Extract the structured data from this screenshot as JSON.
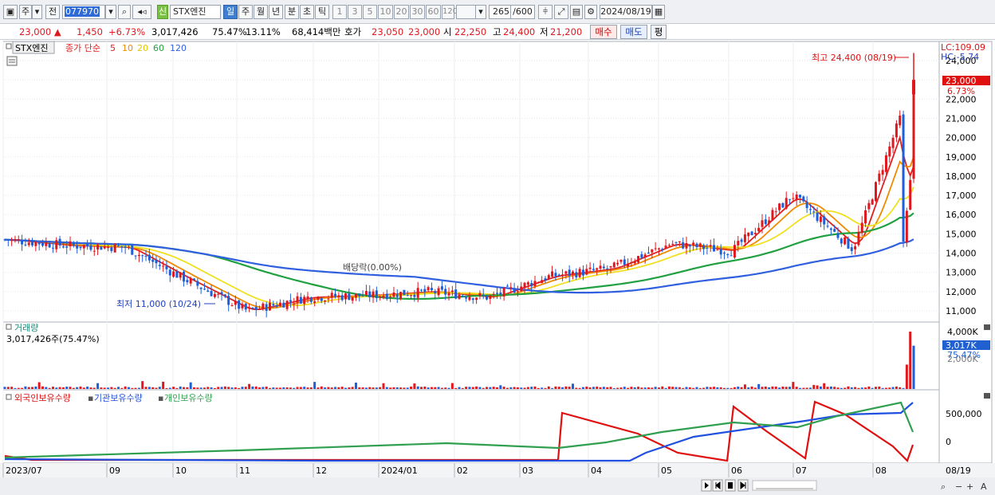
{
  "toolbar": {
    "unit_label": "주",
    "prev_label": "전",
    "stock_code": "077970",
    "credit_badge": "신",
    "stock_name": "STX엔진",
    "periods": [
      "일",
      "주",
      "월",
      "년",
      "분",
      "초",
      "틱"
    ],
    "active_period": "일",
    "intervals": [
      "1",
      "3",
      "5",
      "10",
      "20",
      "30",
      "60",
      "120"
    ],
    "count_value": "265",
    "count_max": "/600",
    "date_value": "2024/08/19"
  },
  "quote": {
    "price": "23,000",
    "change": "1,450",
    "change_rate": "+6.73%",
    "volume": "3,017,426",
    "volume_ratio": "75.47%",
    "turnover": "13.11%",
    "amount": "68,414백만",
    "ask_label": "호가",
    "ask": "23,050",
    "bid": "23,000",
    "open_label": "시",
    "open": "22,250",
    "high_label": "고",
    "high": "24,400",
    "low_label": "저",
    "low": "21,200",
    "buy_label": "매수",
    "sell_label": "매도",
    "eval_label": "평"
  },
  "colors": {
    "up": "#e0181e",
    "down": "#1c5fd8",
    "ma5": "#e02020",
    "ma10": "#f08a00",
    "ma20": "#f0e020",
    "ma60": "#20a040",
    "ma120": "#3060e0",
    "foreign": "#e01010",
    "institution": "#2050e0",
    "individual": "#30a050"
  },
  "price_panel": {
    "stock_tag": "STX엔진",
    "legend_prefix": "종가 단순",
    "ma_labels": [
      "5",
      "10",
      "20",
      "60",
      "120"
    ],
    "lc_label": "LC:109.09",
    "hc_label": "HC:-5.74",
    "current_price_tag": "23,000",
    "current_rate_tag": "6.73%",
    "high_marker": "최고 24,400 (08/19)",
    "low_marker": "최저 11,000 (10/24)",
    "dividend_marker": "배당락(0.00%)",
    "y_ticks": [
      "24,000",
      "23,000",
      "22,000",
      "21,000",
      "20,000",
      "19,000",
      "18,000",
      "17,000",
      "16,000",
      "15,000",
      "14,000",
      "13,000",
      "12,000",
      "11,000"
    ]
  },
  "volume_panel": {
    "title": "거래량",
    "value_label": "3,017,426주(75.47%)",
    "y_ticks": [
      "4,000K",
      "2,000K"
    ],
    "current_tag": "3,017K",
    "current_ratio_tag": "75.47%"
  },
  "holding_panel": {
    "legend": [
      "외국인보유수량",
      "기관보유수량",
      "개인보유수량"
    ],
    "y_ticks": [
      "500,000",
      "0"
    ]
  },
  "x_axis": {
    "labels": [
      "2023/07",
      "09",
      "10",
      "11",
      "12",
      "2024/01",
      "02",
      "03",
      "04",
      "05",
      "06",
      "07",
      "08"
    ],
    "right_label": "08/19"
  },
  "chart_data": {
    "type": "candlestick",
    "period": "daily",
    "range": [
      "2023/07",
      "2024/08/19"
    ],
    "ylim": [
      10500,
      24500
    ],
    "close_points": [
      {
        "date": "2023/07",
        "close": 14700
      },
      {
        "date": "2023/08",
        "close": 14400
      },
      {
        "date": "2023/09",
        "close": 14300
      },
      {
        "date": "2023/10",
        "close": 12600
      },
      {
        "date": "2023/10/24",
        "close": 11000
      },
      {
        "date": "2023/11",
        "close": 11700
      },
      {
        "date": "2023/12",
        "close": 11800
      },
      {
        "date": "2024/01",
        "close": 12000
      },
      {
        "date": "2024/02",
        "close": 11700
      },
      {
        "date": "2024/03",
        "close": 12800
      },
      {
        "date": "2024/04",
        "close": 13200
      },
      {
        "date": "2024/05",
        "close": 14500
      },
      {
        "date": "2024/06",
        "close": 14100
      },
      {
        "date": "2024/07",
        "close": 17000
      },
      {
        "date": "2024/08",
        "close": 14200
      },
      {
        "date": "2024/08/19",
        "close": 23000
      }
    ],
    "max": {
      "value": 24400,
      "date": "08/19"
    },
    "min": {
      "value": 11000,
      "date": "10/24"
    },
    "moving_averages": [
      "5",
      "10",
      "20",
      "60",
      "120"
    ],
    "last_volume": 3017426,
    "volume_ylim_k": [
      0,
      4000
    ]
  }
}
